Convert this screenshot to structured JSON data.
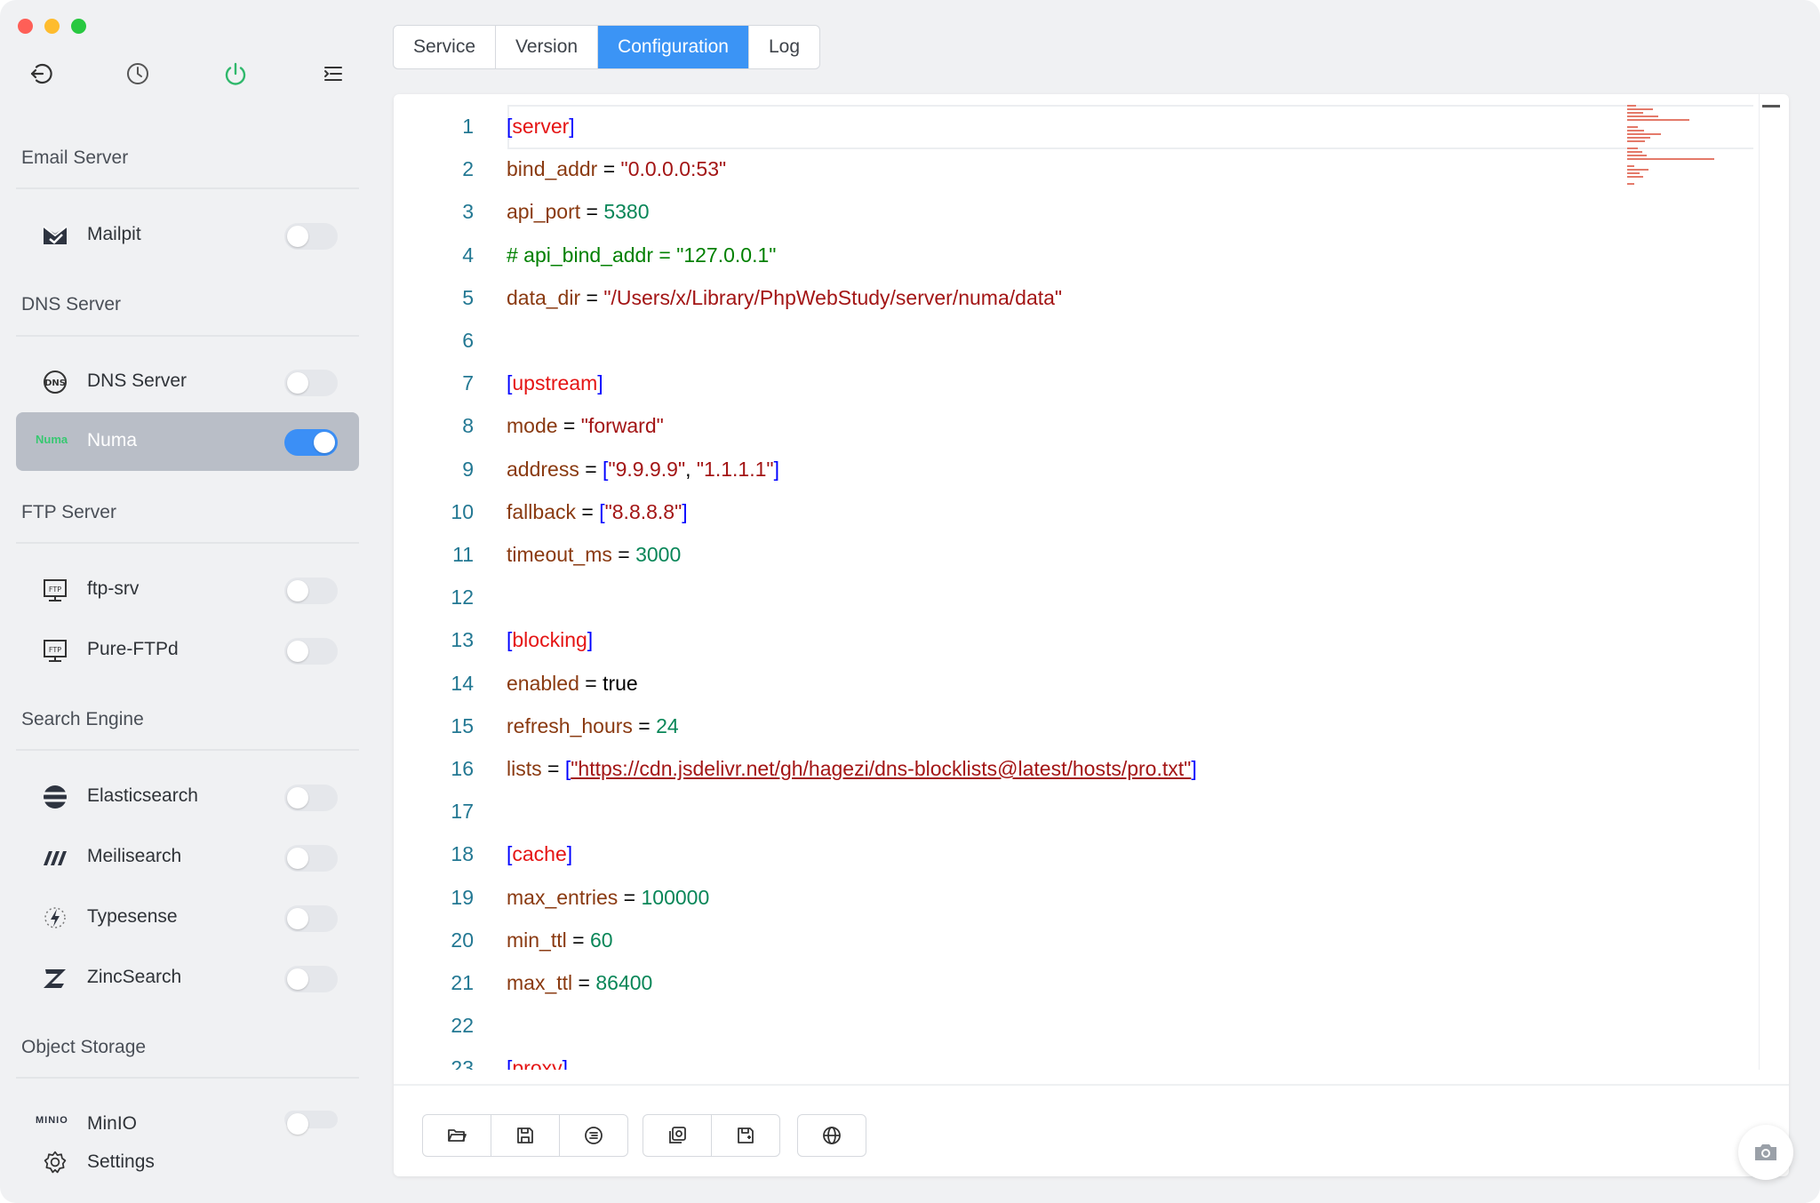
{
  "colors": {
    "accent": "#3b94f5",
    "toggle_on": "#3b8ff6",
    "power_green": "#2fb86b"
  },
  "toolbar": {
    "icons": [
      "back-icon",
      "history-icon",
      "power-icon",
      "menu-icon"
    ]
  },
  "sidebar": {
    "sections": [
      {
        "title": "Email Server",
        "items": [
          {
            "label": "Mailpit",
            "icon": "mailpit-icon",
            "enabled": false
          }
        ]
      },
      {
        "title": "DNS Server",
        "items": [
          {
            "label": "DNS Server",
            "icon": "dns-icon",
            "enabled": false
          },
          {
            "label": "Numa",
            "logo_text": "Numa",
            "enabled": true,
            "selected": true
          }
        ]
      },
      {
        "title": "FTP Server",
        "items": [
          {
            "label": "ftp-srv",
            "icon": "ftp-icon",
            "enabled": false
          },
          {
            "label": "Pure-FTPd",
            "icon": "ftp-icon",
            "enabled": false
          }
        ]
      },
      {
        "title": "Search Engine",
        "items": [
          {
            "label": "Elasticsearch",
            "icon": "elasticsearch-icon",
            "enabled": false
          },
          {
            "label": "Meilisearch",
            "icon": "meilisearch-icon",
            "enabled": false
          },
          {
            "label": "Typesense",
            "icon": "typesense-icon",
            "enabled": false
          },
          {
            "label": "ZincSearch",
            "icon": "zincsearch-icon",
            "enabled": false
          }
        ]
      },
      {
        "title": "Object Storage",
        "items": [
          {
            "label": "MinIO",
            "logo_text": "MINIO",
            "enabled": false
          }
        ]
      }
    ],
    "settings_label": "Settings"
  },
  "tabs": [
    {
      "label": "Service",
      "active": false
    },
    {
      "label": "Version",
      "active": false
    },
    {
      "label": "Configuration",
      "active": true
    },
    {
      "label": "Log",
      "active": false
    }
  ],
  "editor": {
    "lines": [
      "[server]",
      "bind_addr = \"0.0.0.0:53\"",
      "api_port = 5380",
      "# api_bind_addr = \"127.0.0.1\"",
      "data_dir = \"/Users/x/Library/PhpWebStudy/server/numa/data\"",
      "",
      "[upstream]",
      "mode = \"forward\"",
      "address = [\"9.9.9.9\", \"1.1.1.1\"]",
      "fallback = [\"8.8.8.8\"]",
      "timeout_ms = 3000",
      "",
      "[blocking]",
      "enabled = true",
      "refresh_hours = 24",
      "lists = [\"https://cdn.jsdelivr.net/gh/hagezi/dns-blocklists@latest/hosts/pro.txt\"]",
      "",
      "[cache]",
      "max_entries = 100000",
      "min_ttl = 60",
      "max_ttl = 86400",
      "",
      "[proxy]"
    ]
  },
  "footer": {
    "group1": [
      "open-folder-icon",
      "save-icon",
      "format-icon"
    ],
    "group2": [
      "load-default-icon",
      "save-default-icon"
    ],
    "group3": [
      "globe-icon"
    ]
  }
}
